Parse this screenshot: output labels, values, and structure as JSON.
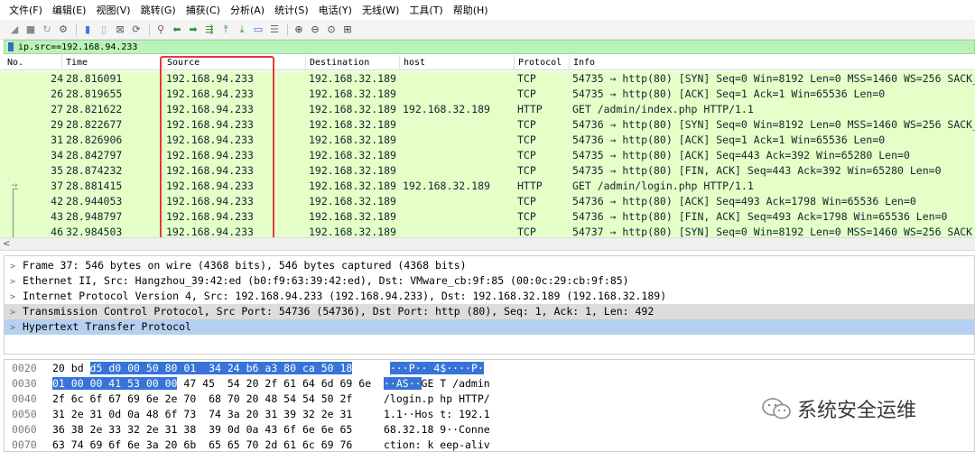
{
  "menu": [
    "文件(F)",
    "编辑(E)",
    "视图(V)",
    "跳转(G)",
    "捕获(C)",
    "分析(A)",
    "统计(S)",
    "电话(Y)",
    "无线(W)",
    "工具(T)",
    "帮助(H)"
  ],
  "filter": {
    "text": "ip.src==192.168.94.233"
  },
  "columns": {
    "no": "No.",
    "time": "Time",
    "source": "Source",
    "destination": "Destination",
    "host": "host",
    "protocol": "Protocol",
    "info": "Info"
  },
  "packets": [
    {
      "no": "24",
      "time": "28.816091",
      "source": "192.168.94.233",
      "destination": "192.168.32.189",
      "host": "",
      "protocol": "TCP",
      "info": "54735 → http(80) [SYN] Seq=0 Win=8192 Len=0 MSS=1460 WS=256 SACK_PERM"
    },
    {
      "no": "26",
      "time": "28.819655",
      "source": "192.168.94.233",
      "destination": "192.168.32.189",
      "host": "",
      "protocol": "TCP",
      "info": "54735 → http(80) [ACK] Seq=1 Ack=1 Win=65536 Len=0"
    },
    {
      "no": "27",
      "time": "28.821622",
      "source": "192.168.94.233",
      "destination": "192.168.32.189",
      "host": "192.168.32.189",
      "protocol": "HTTP",
      "info": "GET /admin/index.php HTTP/1.1"
    },
    {
      "no": "29",
      "time": "28.822677",
      "source": "192.168.94.233",
      "destination": "192.168.32.189",
      "host": "",
      "protocol": "TCP",
      "info": "54736 → http(80) [SYN] Seq=0 Win=8192 Len=0 MSS=1460 WS=256 SACK_PERM"
    },
    {
      "no": "31",
      "time": "28.826906",
      "source": "192.168.94.233",
      "destination": "192.168.32.189",
      "host": "",
      "protocol": "TCP",
      "info": "54736 → http(80) [ACK] Seq=1 Ack=1 Win=65536 Len=0"
    },
    {
      "no": "34",
      "time": "28.842797",
      "source": "192.168.94.233",
      "destination": "192.168.32.189",
      "host": "",
      "protocol": "TCP",
      "info": "54735 → http(80) [ACK] Seq=443 Ack=392 Win=65280 Len=0"
    },
    {
      "no": "35",
      "time": "28.874232",
      "source": "192.168.94.233",
      "destination": "192.168.32.189",
      "host": "",
      "protocol": "TCP",
      "info": "54735 → http(80) [FIN, ACK] Seq=443 Ack=392 Win=65280 Len=0"
    },
    {
      "no": "37",
      "time": "28.881415",
      "source": "192.168.94.233",
      "destination": "192.168.32.189",
      "host": "192.168.32.189",
      "protocol": "HTTP",
      "info": "GET /admin/login.php HTTP/1.1"
    },
    {
      "no": "42",
      "time": "28.944053",
      "source": "192.168.94.233",
      "destination": "192.168.32.189",
      "host": "",
      "protocol": "TCP",
      "info": "54736 → http(80) [ACK] Seq=493 Ack=1798 Win=65536 Len=0"
    },
    {
      "no": "43",
      "time": "28.948797",
      "source": "192.168.94.233",
      "destination": "192.168.32.189",
      "host": "",
      "protocol": "TCP",
      "info": "54736 → http(80) [FIN, ACK] Seq=493 Ack=1798 Win=65536 Len=0"
    },
    {
      "no": "46",
      "time": "32.984503",
      "source": "192.168.94.233",
      "destination": "192.168.32.189",
      "host": "",
      "protocol": "TCP",
      "info": "54737 → http(80) [SYN] Seq=0 Win=8192 Len=0 MSS=1460 WS=256 SACK_PERM"
    }
  ],
  "details": [
    "Frame 37: 546 bytes on wire (4368 bits), 546 bytes captured (4368 bits)",
    "Ethernet II, Src: Hangzhou_39:42:ed (b0:f9:63:39:42:ed), Dst: VMware_cb:9f:85 (00:0c:29:cb:9f:85)",
    "Internet Protocol Version 4, Src: 192.168.94.233 (192.168.94.233), Dst: 192.168.32.189 (192.168.32.189)",
    "Transmission Control Protocol, Src Port: 54736 (54736), Dst Port: http (80), Seq: 1, Ack: 1, Len: 492",
    "Hypertext Transfer Protocol"
  ],
  "bytes_rows": [
    {
      "offset": "0020",
      "hex_plain": "20 bd ",
      "hex_sel": "d5 d0 00 50 80 01  34 24 b6 a3 80 ca 50 18",
      "hex_after": "",
      "ascii_plain": " ",
      "ascii_sel": "···P·· 4$····P·",
      "ascii_after": ""
    },
    {
      "offset": "0030",
      "hex_plain": "",
      "hex_sel": "01 00 00 41 53 00 00",
      "hex_after": " 47 45  54 20 2f 61 64 6d 69 6e",
      "ascii_plain": "",
      "ascii_sel": "··AS··",
      "ascii_after": "GE T /admin"
    },
    {
      "offset": "0040",
      "hex_plain": "2f 6c 6f 67 69 6e 2e 70  68 70 20 48 54 54 50 2f",
      "hex_sel": "",
      "hex_after": "",
      "ascii_plain": "/login.p hp HTTP/",
      "ascii_sel": "",
      "ascii_after": ""
    },
    {
      "offset": "0050",
      "hex_plain": "31 2e 31 0d 0a 48 6f 73  74 3a 20 31 39 32 2e 31",
      "hex_sel": "",
      "hex_after": "",
      "ascii_plain": "1.1··Hos t: 192.1",
      "ascii_sel": "",
      "ascii_after": ""
    },
    {
      "offset": "0060",
      "hex_plain": "36 38 2e 33 32 2e 31 38  39 0d 0a 43 6f 6e 6e 65",
      "hex_sel": "",
      "hex_after": "",
      "ascii_plain": "68.32.18 9··Conne",
      "ascii_sel": "",
      "ascii_after": ""
    },
    {
      "offset": "0070",
      "hex_plain": "63 74 69 6f 6e 3a 20 6b  65 65 70 2d 61 6c 69 76",
      "hex_sel": "",
      "hex_after": "",
      "ascii_plain": "ction: k eep-aliv",
      "ascii_sel": "",
      "ascii_after": ""
    }
  ],
  "watermark": {
    "text": "系统安全运维"
  },
  "colors": {
    "row_bg": "#e4ffc7",
    "filter_bg": "#b9f3b9",
    "highlight_border": "#e23b3b",
    "selected_bg": "#b5d0f0",
    "byte_sel_bg": "#3874d8"
  }
}
